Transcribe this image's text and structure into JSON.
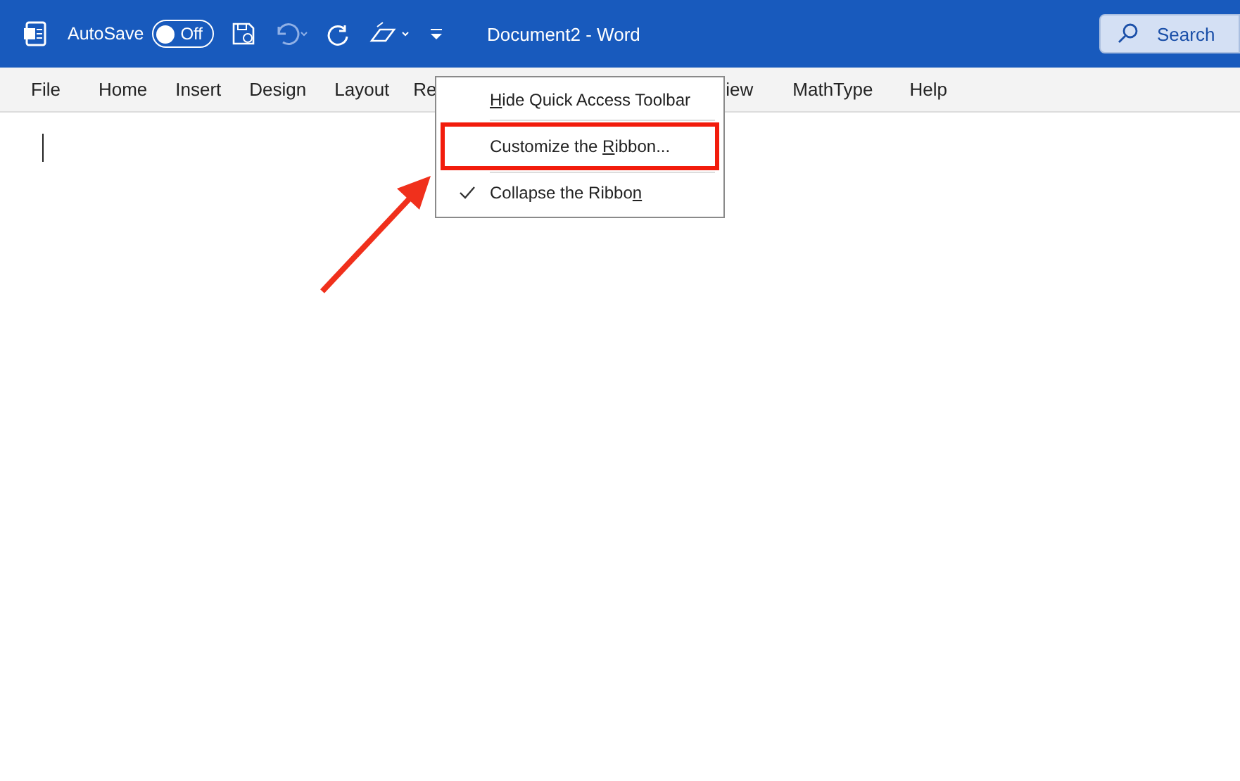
{
  "title_bar": {
    "autosave_label": "AutoSave",
    "autosave": {
      "on": false,
      "text": "Off"
    },
    "document_title": "Document2  -  Word",
    "search": {
      "placeholder": "Search"
    }
  },
  "ribbon_tabs": [
    {
      "label": "File"
    },
    {
      "label": "Home"
    },
    {
      "label": "Insert"
    },
    {
      "label": "Design"
    },
    {
      "label": "Layout"
    },
    {
      "label": "Re"
    },
    {
      "label": "iew"
    },
    {
      "label": "MathType"
    },
    {
      "label": "Help"
    }
  ],
  "context_menu": {
    "items": [
      {
        "key": "H",
        "after": "ide Quick Access Toolbar",
        "checked": false,
        "highlighted": false
      },
      {
        "before": "Customize the ",
        "key": "R",
        "after": "ibbon...",
        "checked": false,
        "highlighted": true
      },
      {
        "before": "Collapse the Ribbo",
        "key": "n",
        "checked": true,
        "highlighted": false
      }
    ]
  }
}
